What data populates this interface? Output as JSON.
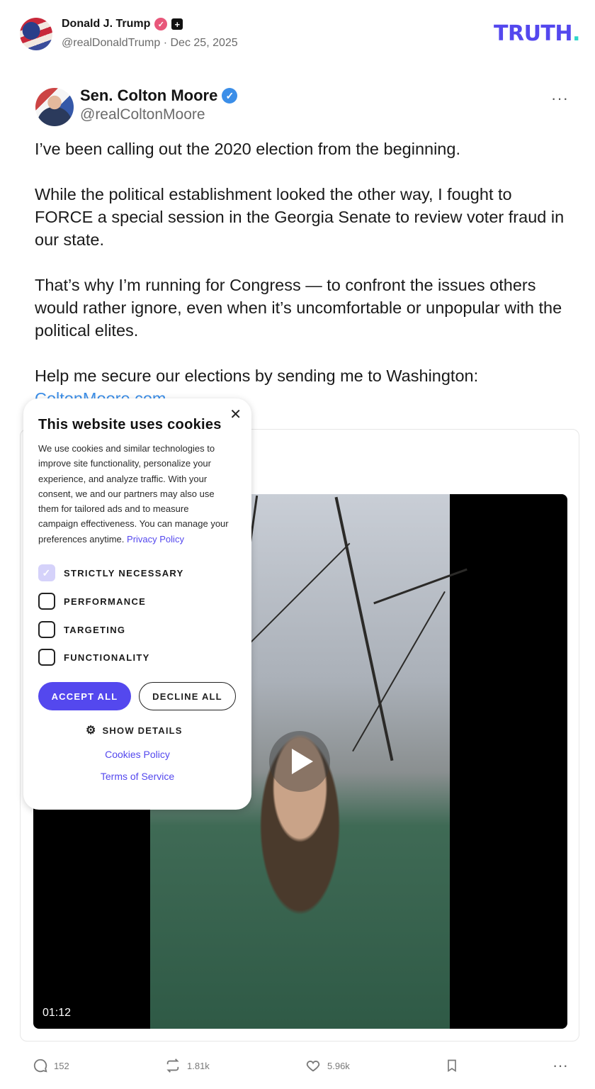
{
  "header": {
    "author_name": "Donald J. Trump",
    "handle": "@realDonaldTrump",
    "separator": "·",
    "date": "Dec 25, 2025",
    "plus_badge": "+",
    "logo_text": "TRUTH",
    "logo_dot": "."
  },
  "quoted_post": {
    "author_name": "Sen. Colton Moore",
    "handle": "@realColtonMoore",
    "verified_check": "✓",
    "more_icon": "···",
    "paragraphs": [
      "I’ve been calling out the 2020 election from the beginning.",
      "While the political establishment looked the other way, I fought to FORCE a special session in the Georgia Senate to review voter fraud in our state.",
      "That’s why I’m running for Congress — to confront the issues others would rather ignore, even when it’s uncomfortable or unpopular with the political elites."
    ],
    "last_paragraph": "Help me secure our elections by sending me to Washington:",
    "link_text": "ColtonMoore.com"
  },
  "video": {
    "duration": "01:12"
  },
  "actions": {
    "replies": "152",
    "retruths": "1.81k",
    "likes": "5.96k",
    "more_icon": "···"
  },
  "cookie_banner": {
    "close_icon": "✕",
    "title": "This website uses cookies",
    "body": "We use cookies and similar technologies to improve site functionality, personalize your experience, and analyze traffic. With your consent, we and our partners may also use them for tailored ads and to measure campaign effectiveness. You can manage your preferences anytime.",
    "privacy_link": "Privacy Policy",
    "options": [
      {
        "label": "STRICTLY NECESSARY",
        "checked": true
      },
      {
        "label": "PERFORMANCE",
        "checked": false
      },
      {
        "label": "TARGETING",
        "checked": false
      },
      {
        "label": "FUNCTIONALITY",
        "checked": false
      }
    ],
    "accept_label": "ACCEPT ALL",
    "decline_label": "DECLINE ALL",
    "show_details_label": "SHOW DETAILS",
    "cookies_policy_link": "Cookies Policy",
    "terms_link": "Terms of Service"
  },
  "colors": {
    "brand": "#5448ee",
    "logo_dot": "#2fd6c9",
    "link": "#3b8ee8"
  }
}
